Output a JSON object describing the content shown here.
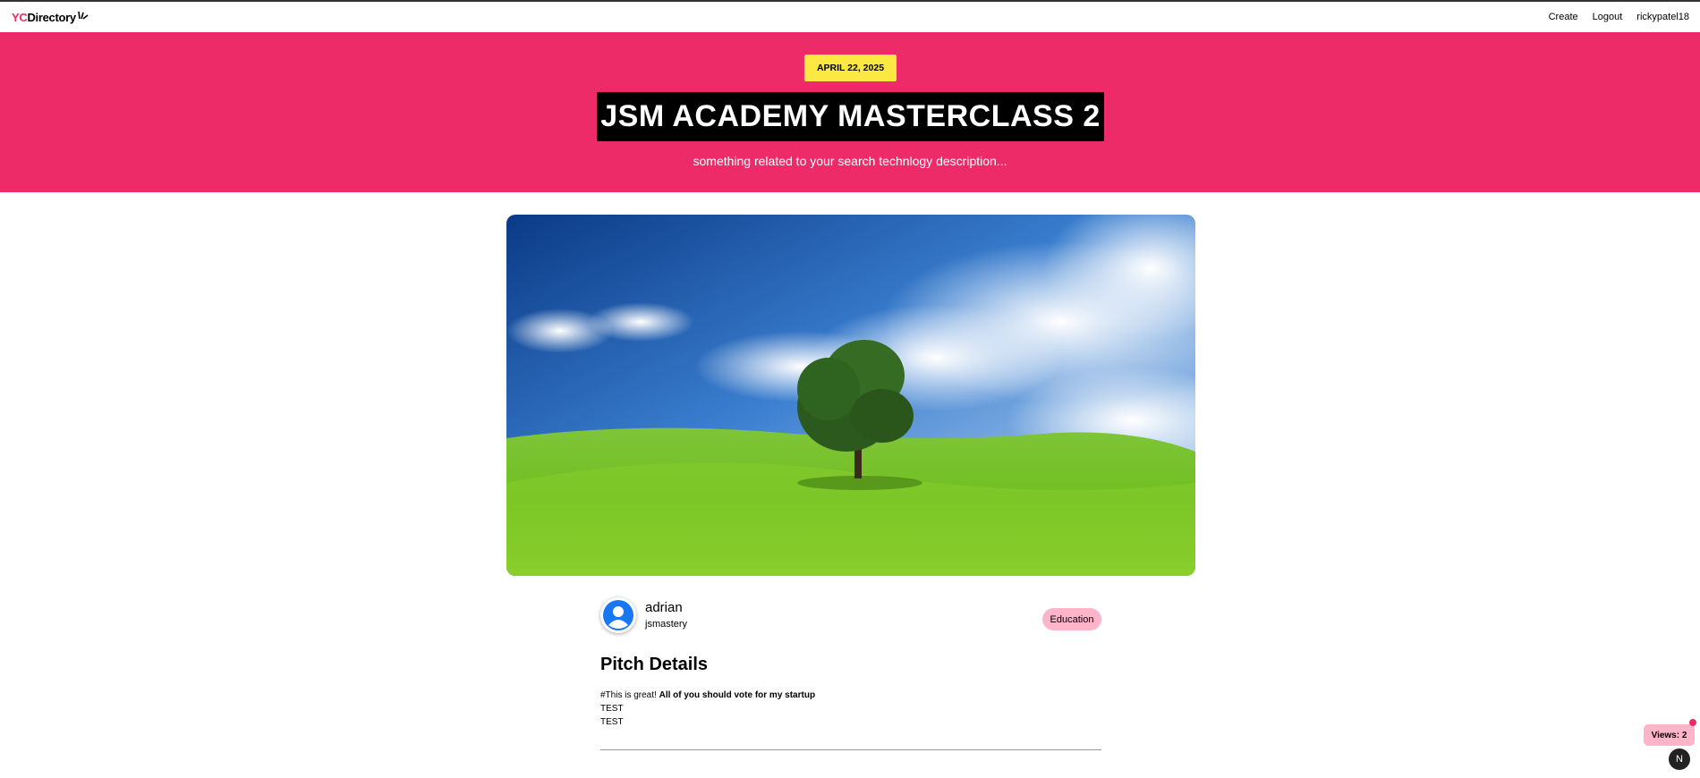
{
  "navbar": {
    "logo": {
      "prefix": "YC",
      "suffix": "Directory"
    },
    "links": {
      "create": "Create",
      "logout": "Logout",
      "user": "rickypatel18"
    }
  },
  "hero": {
    "date": "APRIL 22, 2025",
    "title": "JSM ACADEMY MASTERCLASS 2",
    "description": "something related to your search technlogy description..."
  },
  "image": {
    "alt": "Tree on green hill under blue sky"
  },
  "author": {
    "name": "adrian",
    "handle": "jsmastery"
  },
  "category": "Education",
  "pitch": {
    "heading": "Pitch Details",
    "line1_plain": "#This is great! ",
    "line1_bold": "All of you should vote for my startup",
    "line2": "TEST",
    "line3": "TEST"
  },
  "views": {
    "label": "Views: 2"
  },
  "next_badge": "N",
  "colors": {
    "primary": "#EE2B69",
    "secondary": "#FBE843",
    "category_bg": "#FFB5C9"
  }
}
